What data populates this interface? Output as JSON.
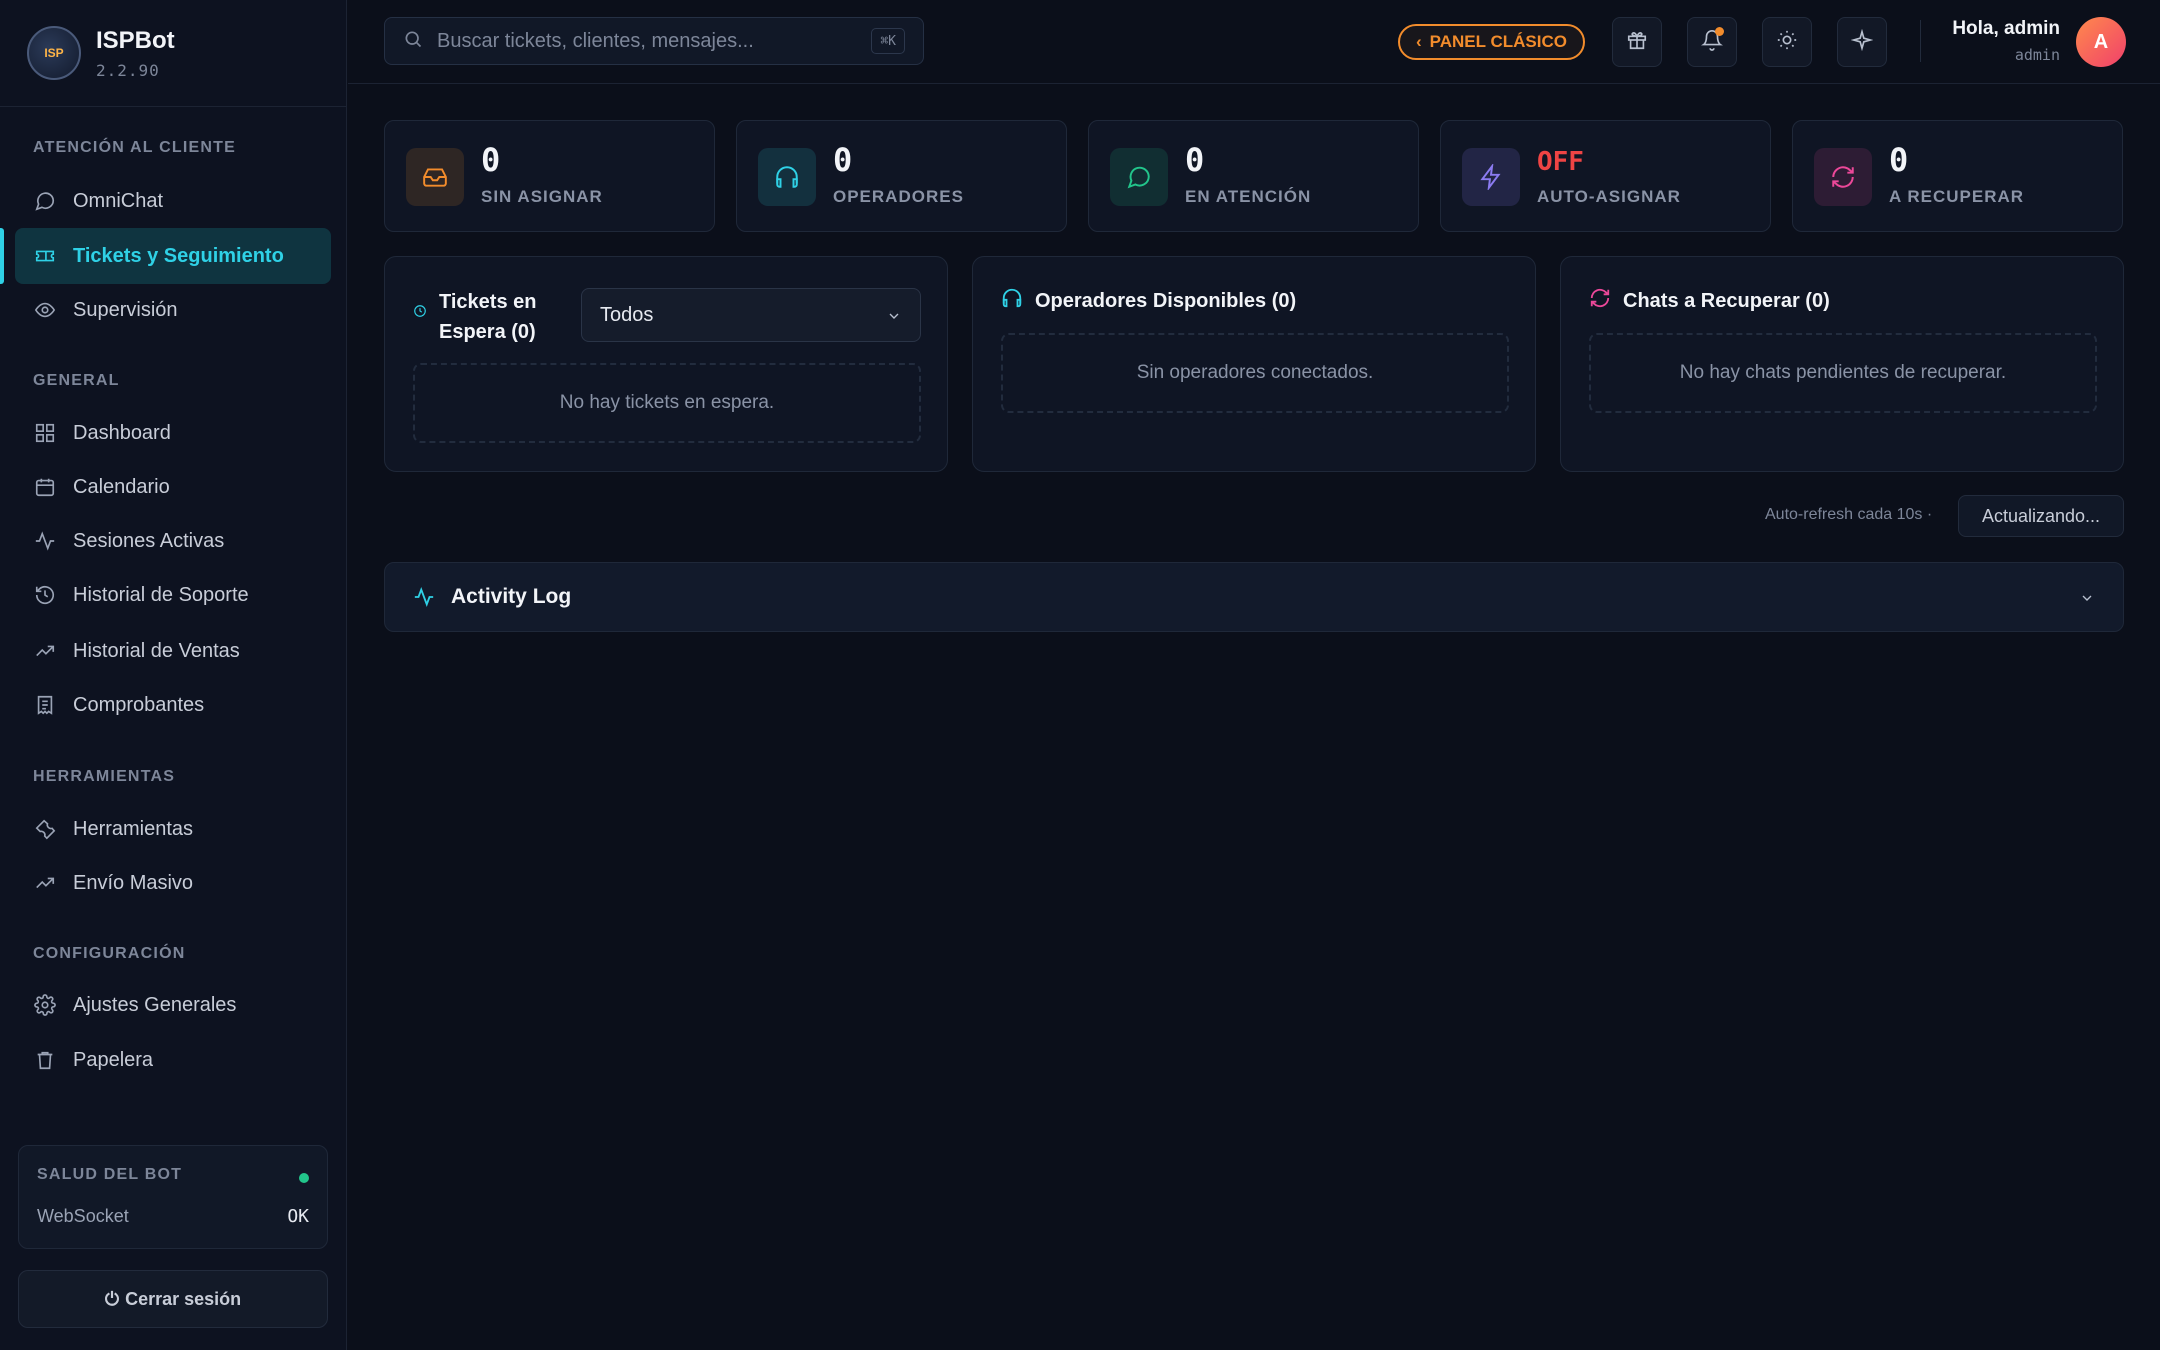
{
  "app": {
    "name": "ISPBot",
    "version": "2.2.90"
  },
  "sidebar": {
    "sections": [
      {
        "title": "ATENCIÓN AL CLIENTE"
      },
      {
        "title": "GENERAL"
      },
      {
        "title": "HERRAMIENTAS"
      },
      {
        "title": "CONFIGURACIÓN"
      }
    ],
    "items": [
      {
        "label": "OmniChat",
        "icon": "chat-icon"
      },
      {
        "label": "Tickets y Seguimiento",
        "icon": "ticket-icon",
        "active": true
      },
      {
        "label": "Supervisión",
        "icon": "eye-icon"
      },
      {
        "label": "Dashboard",
        "icon": "grid-icon"
      },
      {
        "label": "Calendario",
        "icon": "calendar-icon"
      },
      {
        "label": "Sesiones Activas",
        "icon": "activity-icon"
      },
      {
        "label": "Historial de Soporte",
        "icon": "history-icon"
      },
      {
        "label": "Historial de Ventas",
        "icon": "trending-icon"
      },
      {
        "label": "Comprobantes",
        "icon": "receipt-icon"
      },
      {
        "label": "Herramientas",
        "icon": "wrench-icon"
      },
      {
        "label": "Envío Masivo",
        "icon": "trending-icon"
      },
      {
        "label": "Ajustes Generales",
        "icon": "gear-icon"
      },
      {
        "label": "Papelera",
        "icon": "trash-icon"
      }
    ],
    "health": {
      "title": "SALUD DEL BOT",
      "label": "WebSocket",
      "value": "OK",
      "status_color": "#22c58b"
    },
    "logout": "Cerrar sesión"
  },
  "topbar": {
    "search_placeholder": "Buscar tickets, clientes, mensajes...",
    "shortcut": "⌘K",
    "panel_button": "PANEL CLÁSICO",
    "greeting": "Hola, admin",
    "role": "admin",
    "avatar_initial": "A"
  },
  "stats": [
    {
      "value": "0",
      "label": "SIN ASIGNAR",
      "icon": "inbox-icon",
      "color": "#f28c2c"
    },
    {
      "value": "0",
      "label": "OPERADORES",
      "icon": "headphones-icon",
      "color": "#2fd1e6"
    },
    {
      "value": "0",
      "label": "EN ATENCIÓN",
      "icon": "chat-icon",
      "color": "#22c58b"
    },
    {
      "value": "OFF",
      "label": "AUTO-ASIGNAR",
      "icon": "bolt-icon",
      "color": "#8b7bf0",
      "value_color": "#ef4444"
    },
    {
      "value": "0",
      "label": "A RECUPERAR",
      "icon": "refresh-icon",
      "color": "#ec4899"
    }
  ],
  "panels": {
    "waiting": {
      "title_line1": "Tickets en",
      "title_line2": "Espera (0)",
      "filter": "Todos",
      "empty": "No hay tickets en espera."
    },
    "operators": {
      "title": "Operadores Disponibles (0)",
      "empty": "Sin operadores conectados."
    },
    "recover": {
      "title": "Chats a Recuperar (0)",
      "empty": "No hay chats pendientes de recuperar."
    }
  },
  "refresh": {
    "text": "Auto-refresh cada 10s ·",
    "button": "Actualizando..."
  },
  "activity_log": {
    "title": "Activity Log"
  }
}
